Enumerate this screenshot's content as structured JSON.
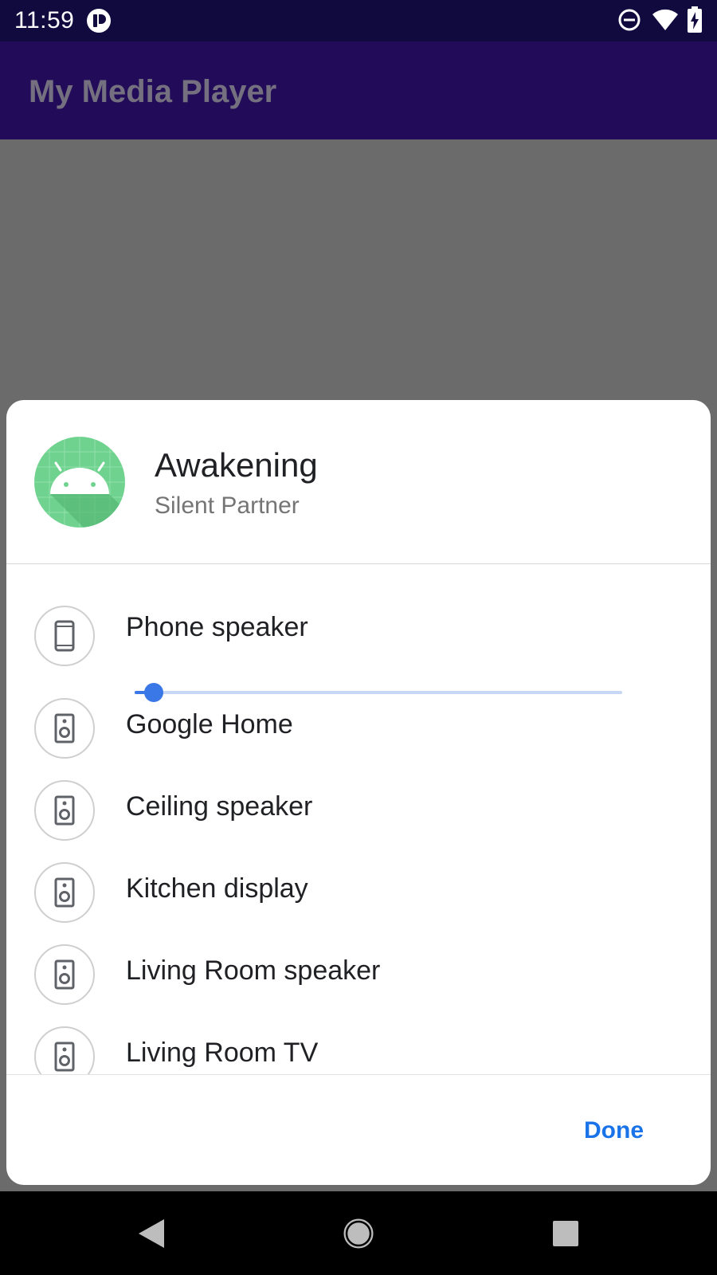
{
  "status_bar": {
    "time": "11:59",
    "icons": [
      "app-notification-icon",
      "do-not-disturb-icon",
      "wifi-icon",
      "battery-charging-icon"
    ]
  },
  "app_bar": {
    "title": "My Media Player"
  },
  "dialog": {
    "media": {
      "title": "Awakening",
      "artist": "Silent Partner",
      "art_icon": "android-album-art"
    },
    "devices": [
      {
        "name": "Phone speaker",
        "icon": "phone-icon",
        "volume_fraction": 0.04
      },
      {
        "name": "Google Home",
        "icon": "speaker-icon"
      },
      {
        "name": "Ceiling speaker",
        "icon": "speaker-icon"
      },
      {
        "name": "Kitchen display",
        "icon": "speaker-icon"
      },
      {
        "name": "Living Room speaker",
        "icon": "speaker-icon"
      },
      {
        "name": "Living Room TV",
        "icon": "speaker-icon"
      }
    ],
    "done_label": "Done"
  },
  "colors": {
    "status_bar": "#110a3f",
    "app_bar": "#220c59",
    "scrim": "#6b6b6b",
    "accent": "#1a73e8",
    "slider_active": "#3b78e7",
    "slider_inactive": "#c6d8f3"
  },
  "nav_bar": {
    "buttons": [
      "back-icon",
      "home-icon",
      "recents-icon"
    ]
  }
}
